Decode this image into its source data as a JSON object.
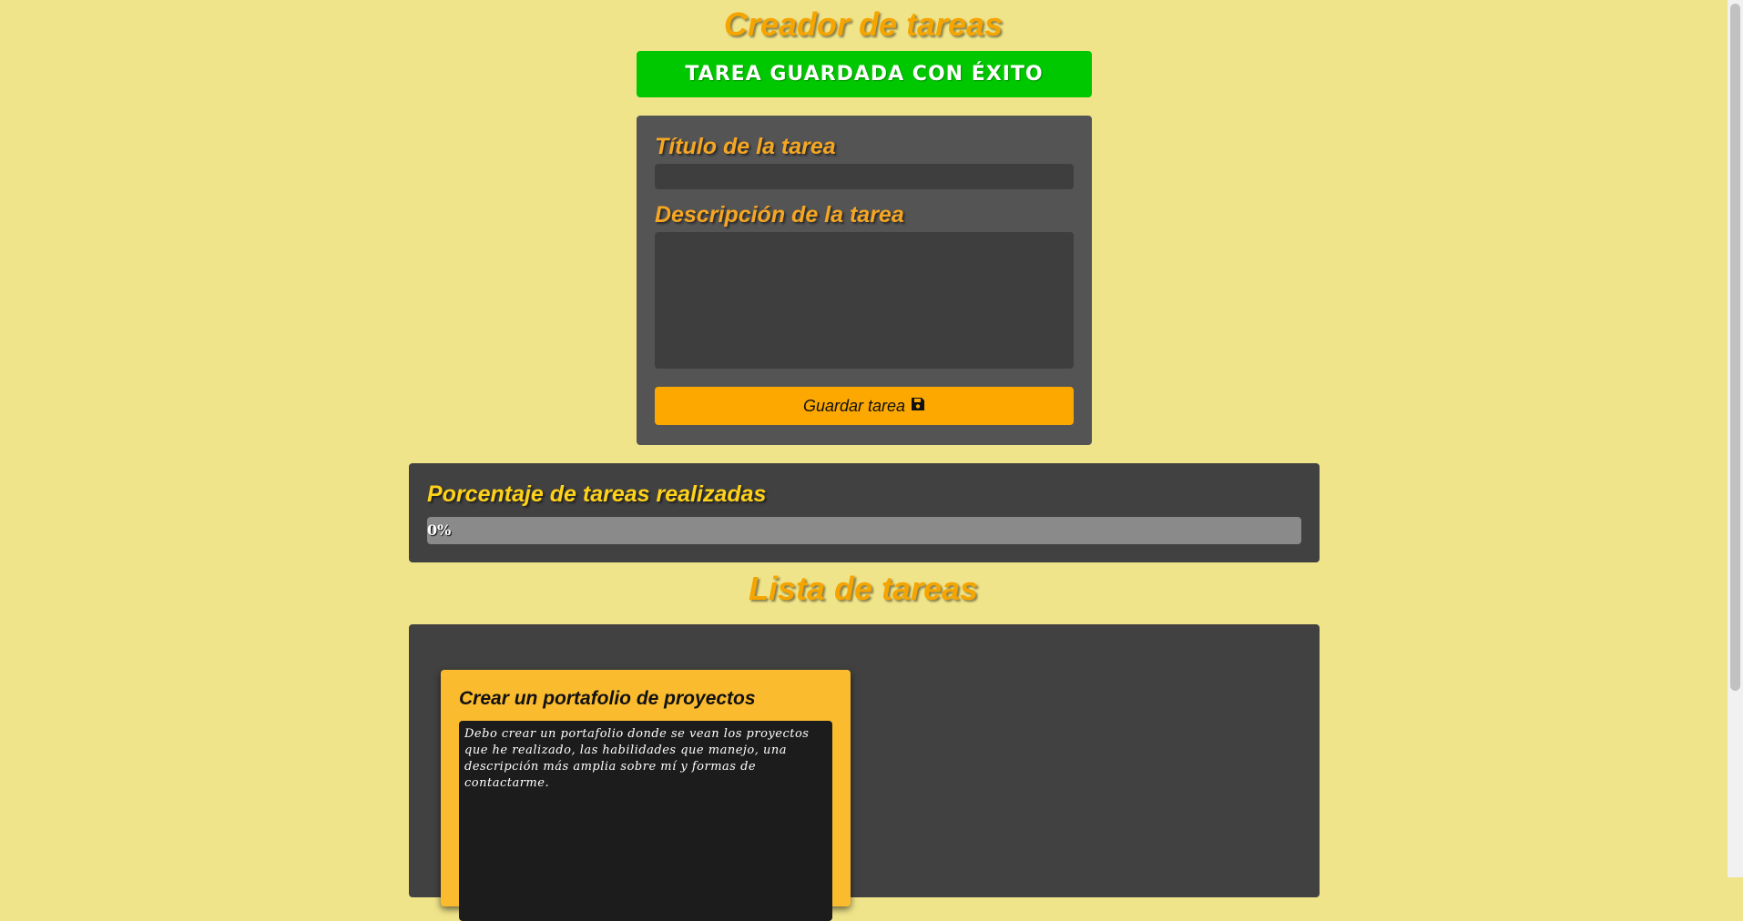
{
  "header": {
    "title": "Creador de tareas"
  },
  "notification": {
    "text": "TAREA GUARDADA CON ÉXITO",
    "color": "#00c800"
  },
  "form": {
    "title_label": "Título de la tarea",
    "title_value": "",
    "description_label": "Descripción de la tarea",
    "description_value": "",
    "save_label": "Guardar tarea",
    "save_icon": "floppy-disk-icon"
  },
  "progress": {
    "title": "Porcentaje de tareas realizadas",
    "percent": 0,
    "label": "0%"
  },
  "task_list": {
    "title": "Lista de tareas",
    "tasks": [
      {
        "title": "Crear un portafolio de proyectos",
        "description": "Debo crear un portafolio donde se vean los proyectos que he realizado, las habilidades que manejo, una descripción más amplia sobre mí y formas de contactarme."
      }
    ]
  },
  "colors": {
    "background": "#f0e48a",
    "accent": "#f5a400",
    "button": "#fca800",
    "card": "#fbbb2f",
    "panel": "#414141"
  }
}
